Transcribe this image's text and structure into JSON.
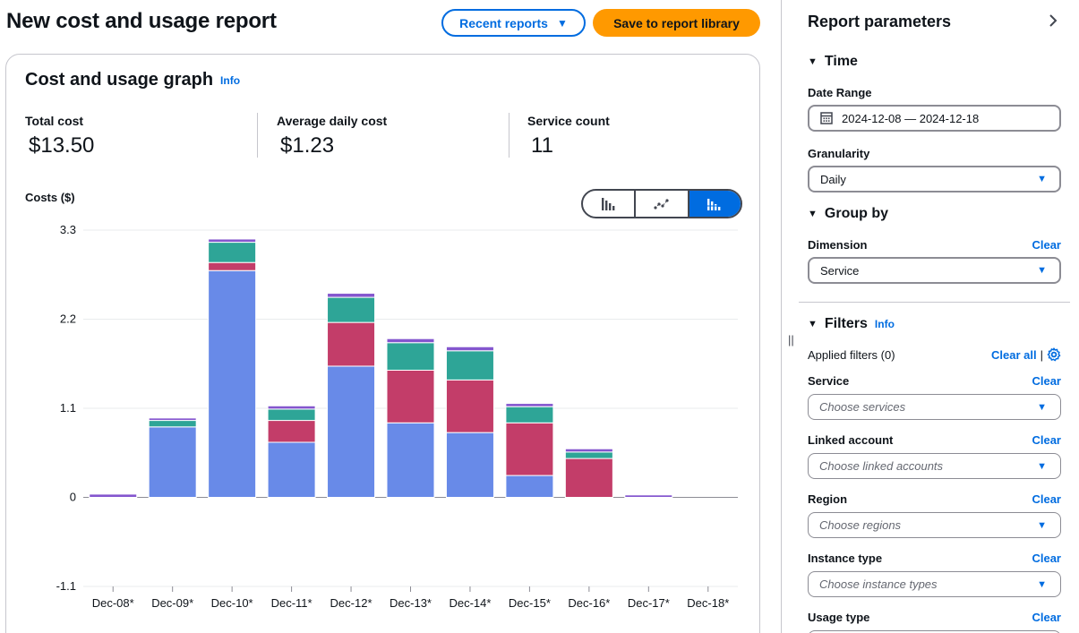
{
  "header": {
    "title": "New cost and usage report",
    "recent_reports_label": "Recent reports",
    "save_label": "Save to report library"
  },
  "graph": {
    "title": "Cost and usage graph",
    "info_label": "Info",
    "kpis": [
      {
        "label": "Total cost",
        "value": "$13.50"
      },
      {
        "label": "Average daily cost",
        "value": "$1.23"
      },
      {
        "label": "Service count",
        "value": "11"
      }
    ],
    "chart_types": [
      "bar",
      "line",
      "stacked"
    ],
    "active_chart_type": "stacked"
  },
  "chart_data": {
    "type": "bar",
    "stacked": true,
    "ylabel": "Costs ($)",
    "ylim": [
      -1.1,
      3.3
    ],
    "yticks": [
      "3.3",
      "2.2",
      "1.1",
      "0",
      "-1.1"
    ],
    "ytick_values": [
      3.3,
      2.2,
      1.1,
      0,
      -1.1
    ],
    "categories": [
      "Dec-08*",
      "Dec-09*",
      "Dec-10*",
      "Dec-11*",
      "Dec-12*",
      "Dec-13*",
      "Dec-14*",
      "Dec-15*",
      "Dec-16*",
      "Dec-17*",
      "Dec-18*"
    ],
    "grid": true,
    "series": [
      {
        "color": "#688ae8",
        "values": [
          0,
          0.87,
          2.8,
          0.68,
          1.62,
          0.92,
          0.8,
          0.27,
          0,
          0,
          0
        ]
      },
      {
        "color": "#c33d69",
        "values": [
          0,
          0,
          0.1,
          0.27,
          0.54,
          0.65,
          0.65,
          0.65,
          0.48,
          0,
          0
        ]
      },
      {
        "color": "#2ea597",
        "values": [
          0,
          0.08,
          0.25,
          0.14,
          0.31,
          0.34,
          0.36,
          0.2,
          0.08,
          0,
          0
        ]
      },
      {
        "color": "#8456ce",
        "values": [
          0.04,
          0.03,
          0.04,
          0.04,
          0.05,
          0.05,
          0.05,
          0.04,
          0.04,
          0.03,
          0
        ]
      }
    ]
  },
  "panel": {
    "title": "Report parameters",
    "time": {
      "heading": "Time",
      "date_range_label": "Date Range",
      "date_range_value": "2024-12-08 — 2024-12-18",
      "granularity_label": "Granularity",
      "granularity_value": "Daily"
    },
    "group_by": {
      "heading": "Group by",
      "dimension_label": "Dimension",
      "clear_label": "Clear",
      "dimension_value": "Service"
    },
    "filters": {
      "heading": "Filters",
      "info_label": "Info",
      "applied_label": "Applied filters (0)",
      "clear_all_label": "Clear all",
      "items": [
        {
          "label": "Service",
          "clear": "Clear",
          "placeholder": "Choose services"
        },
        {
          "label": "Linked account",
          "clear": "Clear",
          "placeholder": "Choose linked accounts"
        },
        {
          "label": "Region",
          "clear": "Clear",
          "placeholder": "Choose regions"
        },
        {
          "label": "Instance type",
          "clear": "Clear",
          "placeholder": "Choose instance types"
        },
        {
          "label": "Usage type",
          "clear": "Clear",
          "placeholder": ""
        }
      ]
    }
  },
  "colors": {
    "accent": "#006ce0",
    "primary_button": "#ff9900",
    "border": "#c6c6cd"
  }
}
